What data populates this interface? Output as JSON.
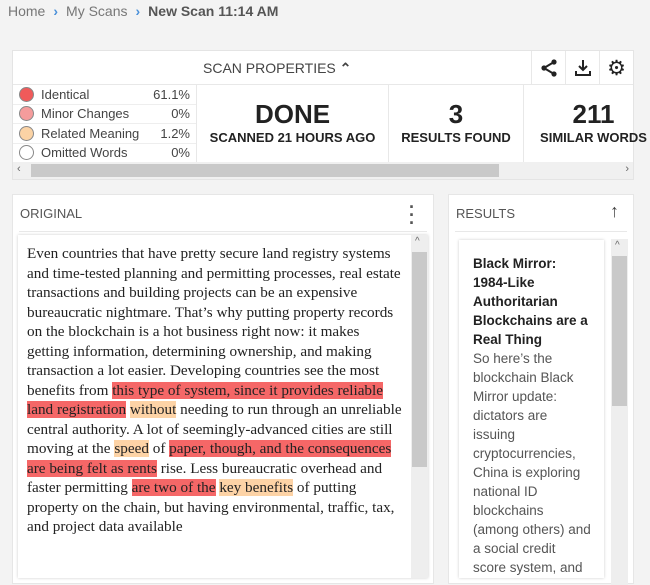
{
  "breadcrumb": {
    "items": [
      "Home",
      "My Scans"
    ],
    "current": "New Scan 11:14 AM"
  },
  "props": {
    "title": "SCAN PROPERTIES",
    "legend": [
      {
        "label": "Identical",
        "pct": "61.1%",
        "color": "#f05a5a"
      },
      {
        "label": "Minor Changes",
        "pct": "0%",
        "color": "#f59c9c"
      },
      {
        "label": "Related Meaning",
        "pct": "1.2%",
        "color": "#fbd3a5"
      },
      {
        "label": "Omitted Words",
        "pct": "0%",
        "color": "#ffffff"
      }
    ],
    "stats": [
      {
        "big": "DONE",
        "small": "SCANNED 21 HOURS AGO"
      },
      {
        "big": "3",
        "small": "RESULTS FOUND"
      },
      {
        "big": "211",
        "small": "SIMILAR WORDS"
      }
    ]
  },
  "original": {
    "title": "ORIGINAL",
    "segments": [
      {
        "t": "plain",
        "text": "Even countries that have pretty secure land registry systems and time-tested planning and permitting processes, real estate transactions and building projects can be an expensive bureaucratic nightmare. That’s why putting property records on the blockchain is a hot business right now: it makes getting information, determining ownership, and making transaction a lot easier. Developing countries see the most benefits from "
      },
      {
        "t": "ident",
        "text": "this type of system, since it provides reliable land registration"
      },
      {
        "t": "plain",
        "text": " "
      },
      {
        "t": "rel",
        "text": "without"
      },
      {
        "t": "plain",
        "text": " needing to run through an unreliable central authority. A lot of seemingly-advanced cities are still moving at the "
      },
      {
        "t": "rel",
        "text": "speed"
      },
      {
        "t": "plain",
        "text": " of "
      },
      {
        "t": "ident",
        "text": "paper, though, and the consequences are being felt as rents"
      },
      {
        "t": "plain",
        "text": " rise. Less bureaucratic overhead and faster permitting "
      },
      {
        "t": "ident",
        "text": "are two of the"
      },
      {
        "t": "plain",
        "text": " "
      },
      {
        "t": "rel",
        "text": "key benefits"
      },
      {
        "t": "plain",
        "text": " of putting property on the chain, but having environmental, traffic, tax, and project data available"
      }
    ]
  },
  "results": {
    "title": "RESULTS",
    "card": {
      "title": "Black Mirror: 1984-Like Authoritarian Blockchains are a Real Thing",
      "body": "So here’s the blockchain Black Mirror update: dictators are issuing cryptocurrencies, China is exploring national ID blockchains (among others) and a social credit score system, and"
    }
  }
}
